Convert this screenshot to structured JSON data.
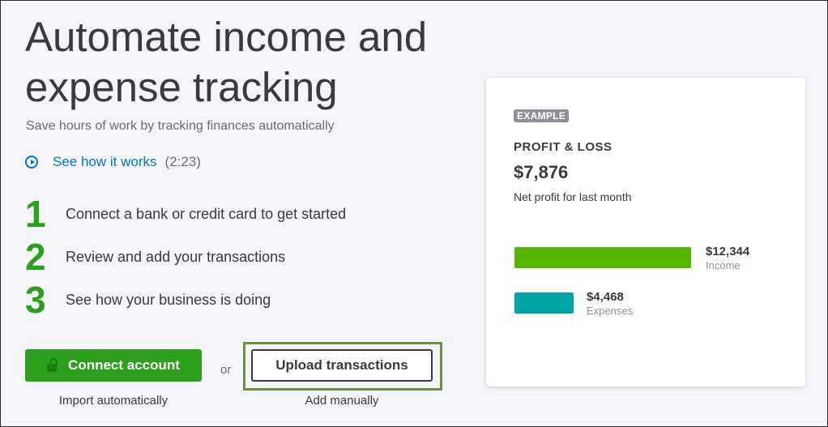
{
  "hero": {
    "title": "Automate income and expense tracking",
    "subtitle": "Save hours of work by tracking finances automatically",
    "video_link": "See how it works",
    "video_duration": "(2:23)"
  },
  "steps": [
    {
      "number": "1",
      "text": "Connect a bank or credit card to get started"
    },
    {
      "number": "2",
      "text": "Review and add your transactions"
    },
    {
      "number": "3",
      "text": "See how your business is doing"
    }
  ],
  "actions": {
    "connect_label": "Connect account",
    "connect_caption": "Import automatically",
    "or_text": "or",
    "upload_label": "Upload transactions",
    "upload_caption": "Add manually"
  },
  "example_card": {
    "badge": "EXAMPLE",
    "heading": "PROFIT & LOSS",
    "amount": "$7,876",
    "caption": "Net profit for last month",
    "income": {
      "value": "$12,344",
      "label": "Income",
      "color": "#53b700"
    },
    "expenses": {
      "value": "$4,468",
      "label": "Expenses",
      "color": "#00a6a4"
    }
  },
  "colors": {
    "accent_green": "#2ca01c",
    "link_blue": "#0077c5",
    "highlight_frame": "#6e8f43"
  }
}
